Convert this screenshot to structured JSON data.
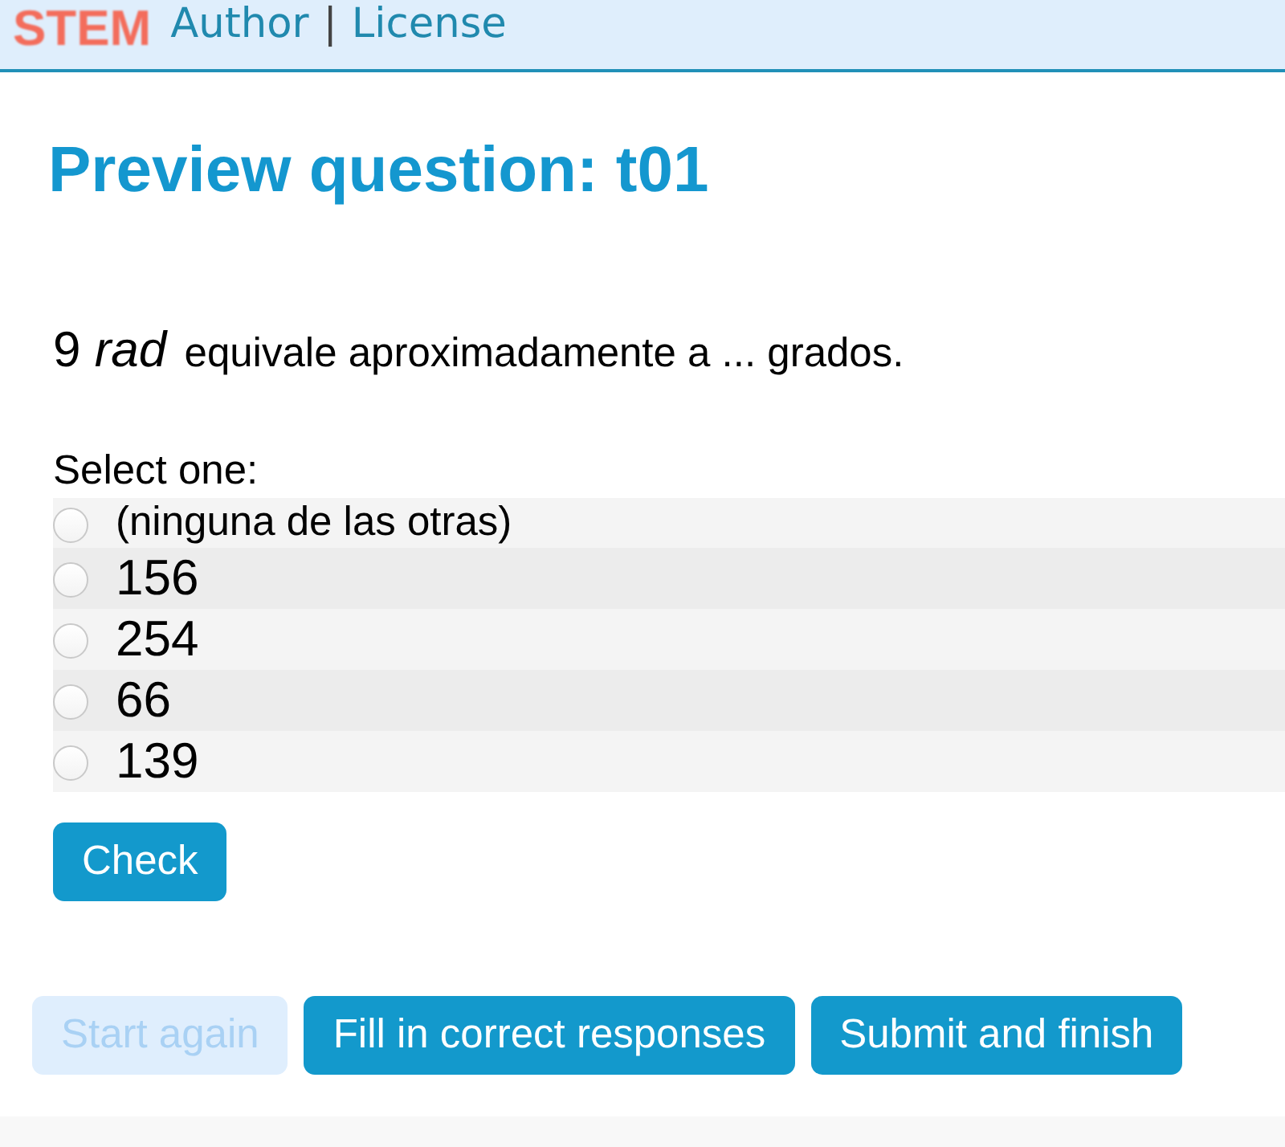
{
  "header": {
    "logo": "STEM",
    "links": [
      {
        "label": "Author"
      },
      {
        "label": "License"
      }
    ],
    "separator": "|"
  },
  "title": "Preview question: t01",
  "question": {
    "math": "9 *rad*",
    "text": "equivale aproximadamente a ... grados."
  },
  "prompt": "Select one:",
  "options": [
    {
      "label": "(ninguna de las otras)",
      "kind": "text",
      "selected": false
    },
    {
      "label": "156",
      "kind": "math",
      "selected": false
    },
    {
      "label": "254",
      "kind": "math",
      "selected": false
    },
    {
      "label": "66",
      "kind": "math",
      "selected": false
    },
    {
      "label": "139",
      "kind": "math",
      "selected": false
    }
  ],
  "check_button": {
    "label": "Check",
    "disabled": false
  },
  "actions": [
    {
      "label": "Start again",
      "disabled": true
    },
    {
      "label": "Fill in correct responses",
      "disabled": false
    },
    {
      "label": "Submit and finish",
      "disabled": false
    }
  ]
}
